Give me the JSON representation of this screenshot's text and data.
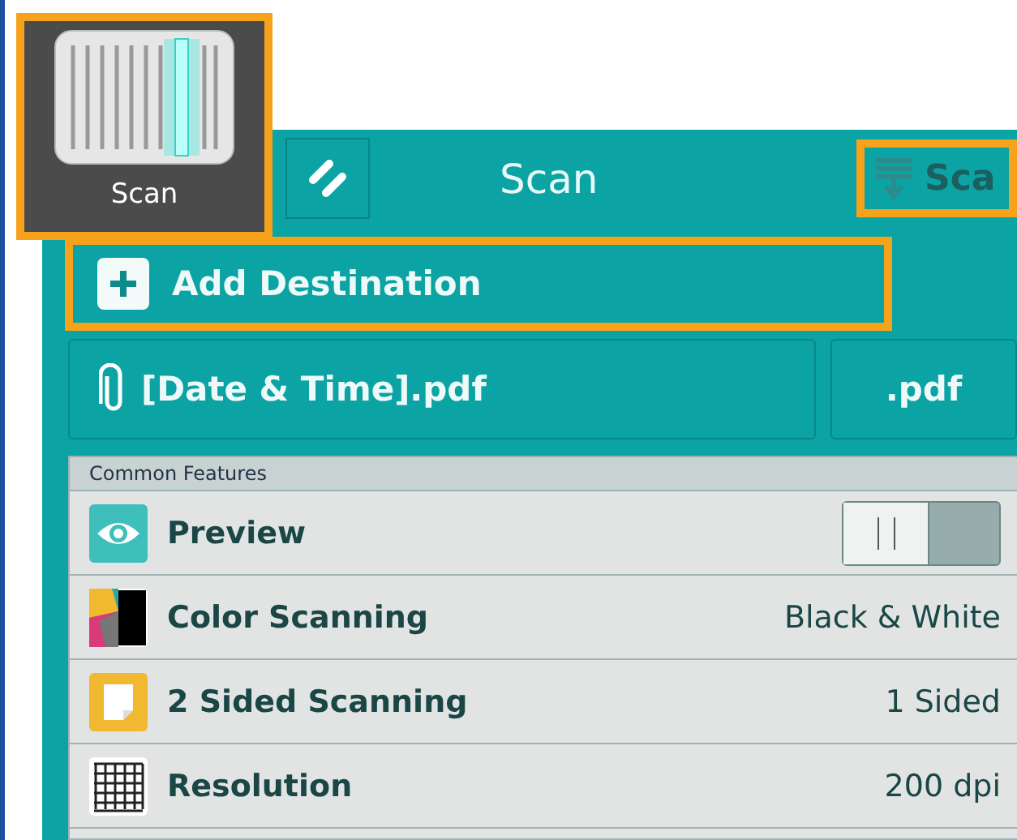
{
  "app_tile": {
    "label": "Scan",
    "highlighted": true
  },
  "header": {
    "title": "Scan",
    "scan_button": {
      "label": "Sca",
      "highlighted": true
    }
  },
  "add_destination": {
    "label": "Add Destination",
    "highlighted": true
  },
  "file": {
    "name": "[Date & Time].pdf",
    "format": ".pdf"
  },
  "features": {
    "heading": "Common Features",
    "items": [
      {
        "kind": "toggle",
        "label": "Preview",
        "on": false
      },
      {
        "kind": "value",
        "label": "Color Scanning",
        "value": "Black & White"
      },
      {
        "kind": "value",
        "label": "2 Sided Scanning",
        "value": "1 Sided"
      },
      {
        "kind": "value",
        "label": "Resolution",
        "value": "200 dpi"
      }
    ]
  }
}
